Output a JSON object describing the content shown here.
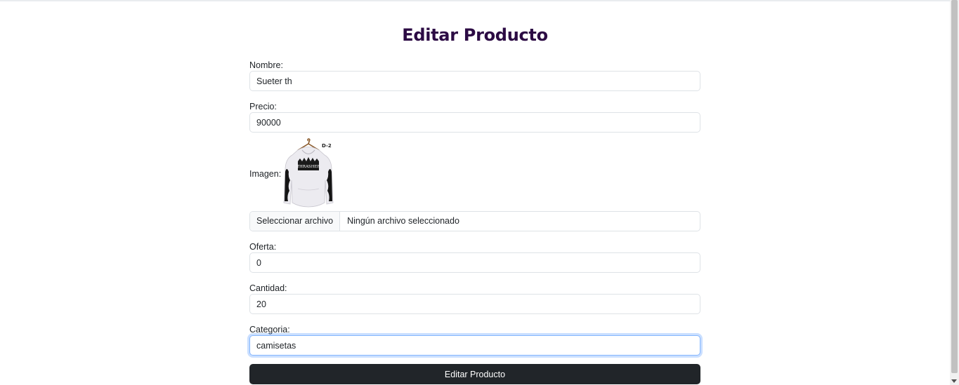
{
  "form": {
    "title": "Editar Producto",
    "nombre_label": "Nombre:",
    "nombre_value": "Sueter th",
    "precio_label": "Precio:",
    "precio_value": "90000",
    "imagen_label": "Imagen:",
    "image_tag": "D-2",
    "file_button_label": "Seleccionar archivo",
    "file_status": "Ningún archivo seleccionado",
    "oferta_label": "Oferta:",
    "oferta_value": "0",
    "cantidad_label": "Cantidad:",
    "cantidad_value": "20",
    "categoria_label": "Categoria:",
    "categoria_value": "camisetas",
    "submit_label": "Editar Producto"
  },
  "colors": {
    "title": "#2c0b44",
    "button_bg": "#212529",
    "focus_border": "#86b7fe"
  }
}
